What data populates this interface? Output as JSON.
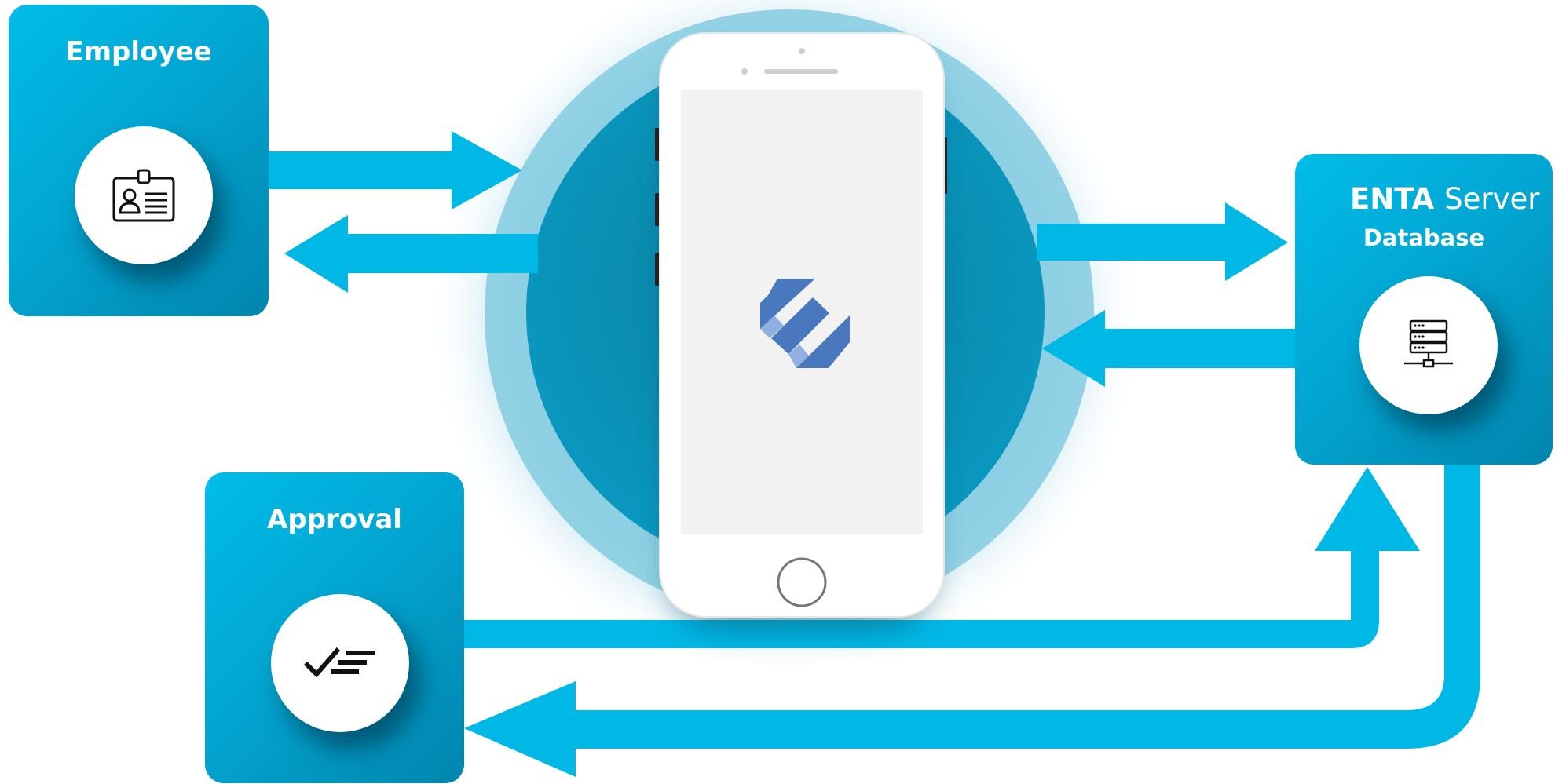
{
  "employee": {
    "title": "Employee",
    "icon": "id-card-icon"
  },
  "server": {
    "title_bold": "ENTA",
    "title_light": "Server",
    "subtitle": "Database",
    "icon": "server-rack-icon"
  },
  "approval": {
    "title": "Approval",
    "icon": "checklist-icon"
  },
  "phone": {
    "logo": "enta-logo"
  },
  "colors": {
    "arrow": "#00b8e6",
    "box_light": "#00bde8",
    "box_dark": "#0185ad",
    "halo": "#0a8fb3",
    "logo": "#4a78bf",
    "logo_light": "#8fb0e0"
  }
}
